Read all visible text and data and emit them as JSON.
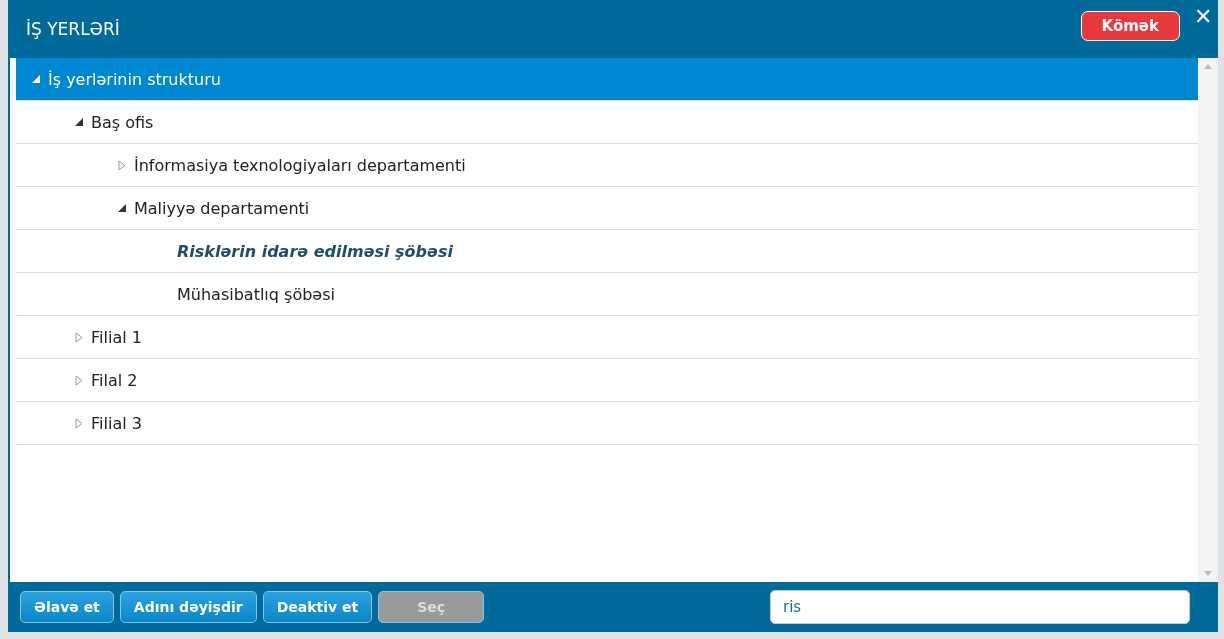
{
  "window": {
    "title": "İŞ YERLƏRİ",
    "help_button": "Kömək",
    "close": "✕"
  },
  "tree": [
    {
      "label": "İş yerlərinin strukturu",
      "selected": true,
      "expanded": true,
      "match": false,
      "children": [
        {
          "label": "Baş ofis",
          "selected": false,
          "expanded": true,
          "match": false,
          "children": [
            {
              "label": "İnformasiya texnologiyaları departamenti",
              "selected": false,
              "expanded": false,
              "match": false
            },
            {
              "label": "Maliyyə departamenti",
              "selected": false,
              "expanded": true,
              "match": false,
              "children": [
                {
                  "label": "Risklərin idarə edilməsi şöbəsi",
                  "selected": false,
                  "match": true
                },
                {
                  "label": "Mühasibatlıq şöbəsi",
                  "selected": false,
                  "match": false
                }
              ]
            }
          ]
        },
        {
          "label": "Filial 1",
          "selected": false,
          "expanded": false,
          "match": false
        },
        {
          "label": "Filal 2",
          "selected": false,
          "expanded": false,
          "match": false
        },
        {
          "label": "Filial 3",
          "selected": false,
          "expanded": false,
          "match": false
        }
      ]
    }
  ],
  "buttons": [
    {
      "label": "Əlavə et",
      "disabled": false
    },
    {
      "label": "Adını dəyişdir",
      "disabled": false
    },
    {
      "label": "Deaktiv et",
      "disabled": false
    },
    {
      "label": "Seç",
      "disabled": true
    }
  ],
  "search": {
    "value": "ris"
  }
}
